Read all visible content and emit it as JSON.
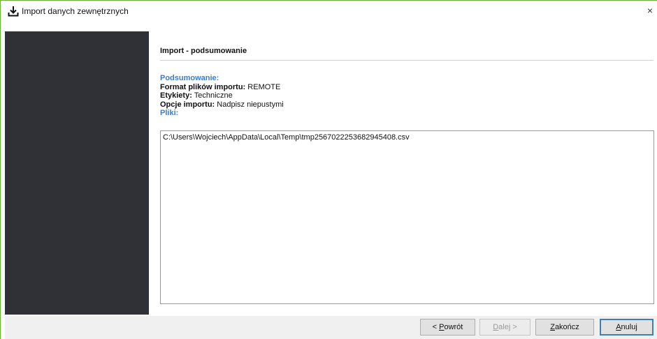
{
  "window": {
    "title": "Import danych zewnętrznych",
    "title_icon": "download-icon",
    "close_symbol": "×"
  },
  "content": {
    "section_title": "Import - podsumowanie",
    "summary_heading": "Podsumowanie:",
    "format_label": "Format plików importu:",
    "format_value": "REMOTE",
    "labels_label": "Etykiety:",
    "labels_value": "Techniczne",
    "options_label": "Opcje importu:",
    "options_value": "Nadpisz niepustymi",
    "files_heading": "Pliki:",
    "files": [
      "C:\\Users\\Wojciech\\AppData\\Local\\Temp\\tmp2567022253682945408.csv"
    ]
  },
  "footer": {
    "back": {
      "mnemonic": "P",
      "rest": "owrót",
      "prefix": "< "
    },
    "next": {
      "mnemonic": "D",
      "rest": "alej",
      "suffix": " >"
    },
    "finish": {
      "mnemonic": "Z",
      "rest": "akończ"
    },
    "cancel": {
      "mnemonic": "A",
      "rest": "nuluj"
    }
  },
  "colors": {
    "sidebar": "#2f3137",
    "accent_blue": "#3d7cc9",
    "window_border": "#6fae3c",
    "footer_bg": "#f0f0f0"
  }
}
